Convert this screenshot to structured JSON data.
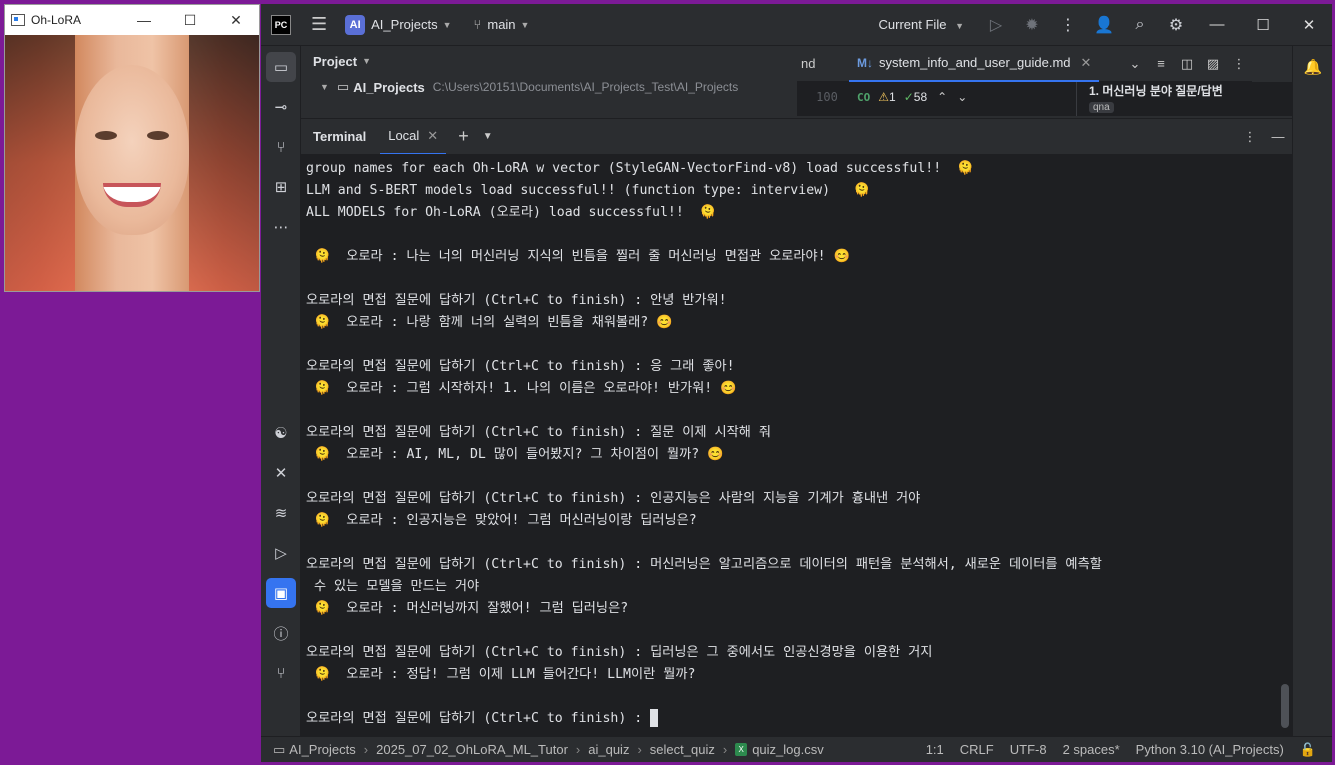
{
  "ohlora_window": {
    "title": "Oh-LoRA",
    "min": "—",
    "max": "☐",
    "close": "✕"
  },
  "ide": {
    "logo": "PC",
    "project_badge": "AI",
    "project_name": "AI_Projects",
    "branch": "main",
    "run_config": "Current File",
    "icons": [
      "hamburger-icon",
      "branch-icon",
      "run-icon",
      "debug-icon",
      "more-icon",
      "add-user-icon",
      "search-icon",
      "gear-icon"
    ]
  },
  "project_pane": {
    "header": "Project",
    "root_name": "AI_Projects",
    "root_path": "C:\\Users\\20151\\Documents\\AI_Projects_Test\\AI_Projects"
  },
  "editor": {
    "tab_truncated": "nd",
    "active_tab": "system_info_and_user_guide.md",
    "line_number": "100",
    "code_badge": "CO",
    "warnings": "1",
    "checks": "58",
    "preview_heading": "1. 머신러닝 분야 질문/답변",
    "preview_tag": "qna"
  },
  "terminal": {
    "title": "Terminal",
    "tab": "Local",
    "lines": [
      "group names for each Oh-LoRA w vector (StyleGAN-VectorFind-v8) load successful!!  🫠",
      "LLM and S-BERT models load successful!! (function type: interview)   🫠",
      "ALL MODELS for Oh-LoRA (오로라) load successful!!  🫠",
      "",
      " 🫠  오로라 : 나는 너의 머신러닝 지식의 빈틈을 찔러 줄 머신러닝 면접관 오로라야! 😊",
      "",
      "오로라의 면접 질문에 답하기 (Ctrl+C to finish) : 안녕 반가워!",
      " 🫠  오로라 : 나랑 함께 너의 실력의 빈틈을 채워볼래? 😊",
      "",
      "오로라의 면접 질문에 답하기 (Ctrl+C to finish) : 응 그래 좋아!",
      " 🫠  오로라 : 그럼 시작하자! 1. 나의 이름은 오로라야! 반가워! 😊",
      "",
      "오로라의 면접 질문에 답하기 (Ctrl+C to finish) : 질문 이제 시작해 줘",
      " 🫠  오로라 : AI, ML, DL 많이 들어봤지? 그 차이점이 뭘까? 😊",
      "",
      "오로라의 면접 질문에 답하기 (Ctrl+C to finish) : 인공지능은 사람의 지능을 기계가 흉내낸 거야",
      " 🫠  오로라 : 인공지능은 맞았어! 그럼 머신러닝이랑 딥러닝은?",
      "",
      "오로라의 면접 질문에 답하기 (Ctrl+C to finish) : 머신러닝은 알고리즘으로 데이터의 패턴을 분석해서, 새로운 데이터를 예측할",
      " 수 있는 모델을 만드는 거야",
      " 🫠  오로라 : 머신러닝까지 잘했어! 그럼 딥러닝은?",
      "",
      "오로라의 면접 질문에 답하기 (Ctrl+C to finish) : 딥러닝은 그 중에서도 인공신경망을 이용한 거지",
      " 🫠  오로라 : 정답! 그럼 이제 LLM 들어간다! LLM이란 뭘까?",
      "",
      "오로라의 면접 질문에 답하기 (Ctrl+C to finish) : "
    ]
  },
  "statusbar": {
    "crumbs": [
      "AI_Projects",
      "2025_07_02_OhLoRA_ML_Tutor",
      "ai_quiz",
      "select_quiz",
      "quiz_log.csv"
    ],
    "position": "1:1",
    "line_sep": "CRLF",
    "encoding": "UTF-8",
    "indent": "2 spaces*",
    "interpreter": "Python 3.10 (AI_Projects)"
  }
}
